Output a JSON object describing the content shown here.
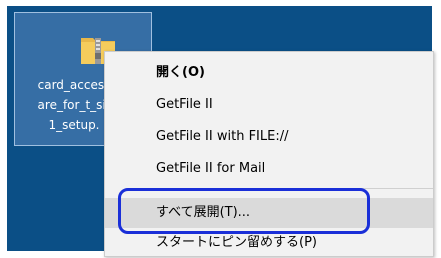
{
  "desktop": {
    "file": {
      "label_lines": [
        "card_access",
        "are_for_t_sit",
        "1_setup."
      ],
      "icon": "zip-folder-icon"
    }
  },
  "context_menu": {
    "items": [
      {
        "label": "開く(O)"
      },
      {
        "label": "GetFile II"
      },
      {
        "label": "GetFile II  with FILE://"
      },
      {
        "label": "GetFile II  for Mail"
      },
      {
        "label": "すべて展開(T)..."
      },
      {
        "label": "スタートにピン留めする(P)"
      }
    ]
  },
  "colors": {
    "desktop_bg": "#0b4f86",
    "menu_bg": "#f2f2f2",
    "highlight": "#1a2fd8"
  }
}
